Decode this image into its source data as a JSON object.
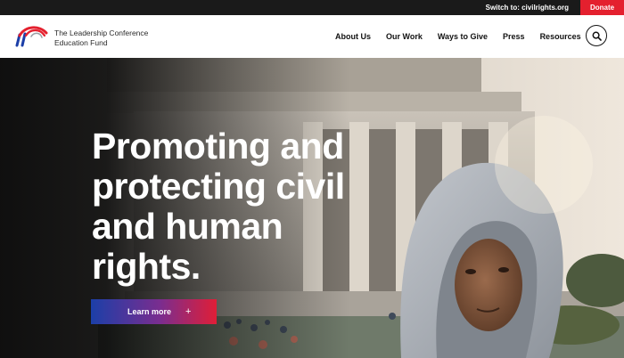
{
  "topbar": {
    "switch_text": "Switch to: civilrights.org",
    "donate_label": "Donate"
  },
  "header": {
    "org_name_line1": "The Leadership Conference",
    "org_name_line2": "Education Fund",
    "nav": [
      "About Us",
      "Our Work",
      "Ways to Give",
      "Press",
      "Resources"
    ]
  },
  "hero": {
    "title_lines": [
      "Promoting and",
      "protecting civil",
      "and human",
      "rights."
    ],
    "cta_label": "Learn more",
    "cta_icon": "+"
  },
  "colors": {
    "accent_red": "#e4202e",
    "accent_blue": "#1c3fa8",
    "topbar_bg": "#1a1a1a"
  },
  "icons": [
    "logo-arcs-icon",
    "search-icon",
    "plus-icon"
  ]
}
